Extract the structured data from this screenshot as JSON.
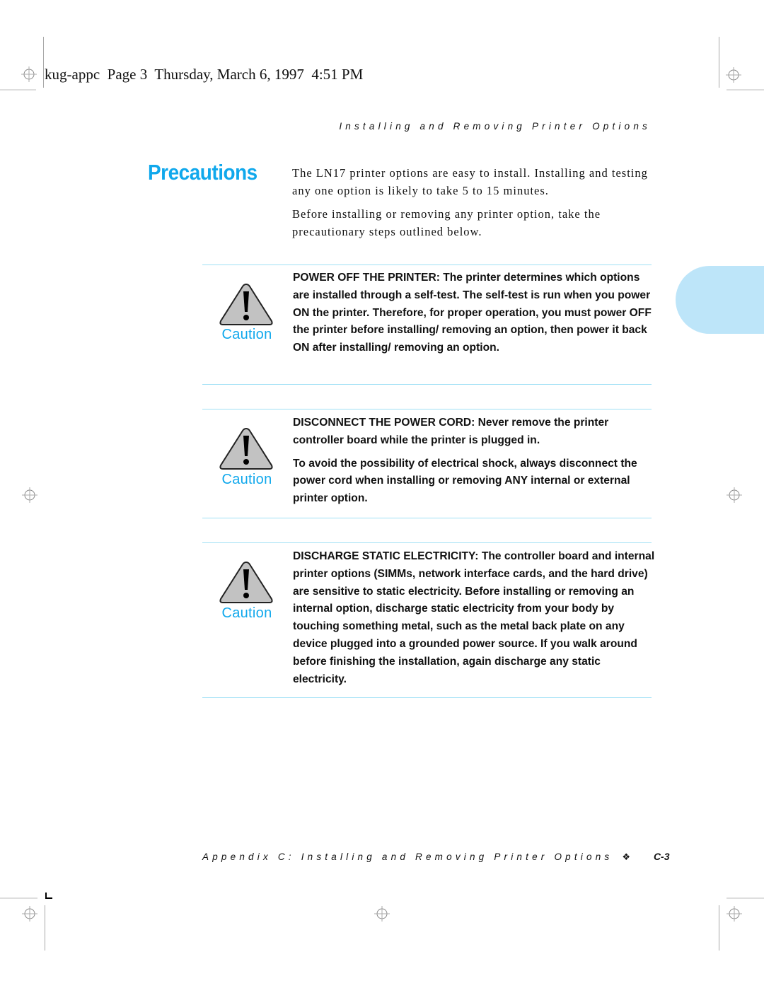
{
  "slug": "kug-appc  Page 3  Thursday, March 6, 1997  4:51 PM",
  "running_head": "Installing and Removing Printer Options",
  "section": {
    "title": "Precautions",
    "intro": [
      "The LN17 printer options are easy to install. Installing and testing any one option is likely to take 5 to 15 minutes.",
      "Before installing or removing any printer option, take the precautionary steps outlined below."
    ]
  },
  "cautions": [
    {
      "icon": "warning-triangle-icon",
      "label": "Caution",
      "paragraphs": [
        "POWER OFF THE PRINTER: The printer determines which options are installed through a self-test. The self-test is run when you power ON the printer. Therefore, for proper operation, you must power OFF the printer before installing/ removing an option, then power it back ON after installing/ removing an option."
      ]
    },
    {
      "icon": "warning-triangle-icon",
      "label": "Caution",
      "paragraphs": [
        "DISCONNECT THE POWER CORD: Never remove the printer controller board while the printer is plugged in.",
        "To avoid the possibility of electrical shock, always disconnect the power cord when installing or removing ANY internal or external printer option."
      ]
    },
    {
      "icon": "warning-triangle-icon",
      "label": "Caution",
      "paragraphs": [
        "DISCHARGE STATIC ELECTRICITY: The controller board and internal printer options (SIMMs, network interface cards, and the hard drive) are sensitive to static electricity. Before installing or removing an internal option, discharge static electricity from your body by touching something metal, such as the metal back plate on any device plugged into a grounded power source. If you walk around before finishing the installation, again discharge any static electricity."
      ]
    }
  ],
  "footer": {
    "text": "Appendix C: Installing and Removing Printer Options",
    "separator": "❖",
    "page_number": "C-3"
  },
  "colors": {
    "accent": "#10a8ec",
    "rule": "#9fe0f5",
    "tab": "#bde5f9"
  }
}
